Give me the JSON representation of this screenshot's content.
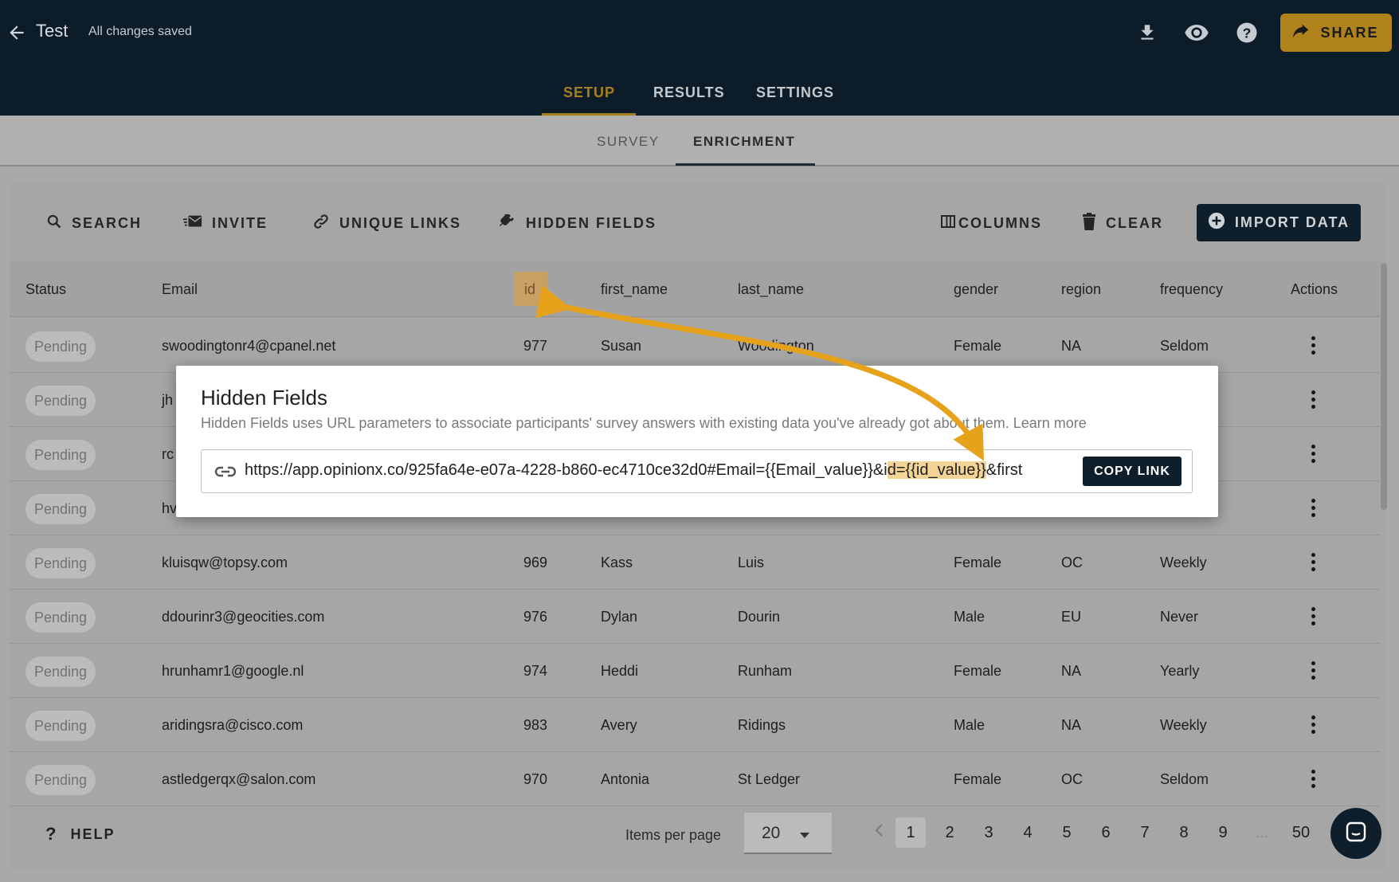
{
  "header": {
    "title": "Test",
    "saved_status": "All changes saved",
    "share_label": "SHARE",
    "nav_tabs": [
      "SETUP",
      "RESULTS",
      "SETTINGS"
    ],
    "sub_tabs": [
      "SURVEY",
      "ENRICHMENT"
    ]
  },
  "toolbar": {
    "search": "SEARCH",
    "invite": "INVITE",
    "unique_links": "UNIQUE LINKS",
    "hidden_fields": "HIDDEN FIELDS",
    "columns": "COLUMNS",
    "clear": "CLEAR",
    "import_data": "IMPORT DATA"
  },
  "table": {
    "columns": [
      "Status",
      "Email",
      "id",
      "first_name",
      "last_name",
      "gender",
      "region",
      "frequency",
      "Actions"
    ],
    "rows": [
      {
        "status": "Pending",
        "email": "swoodingtonr4@cpanel.net",
        "id": "977",
        "first_name": "Susan",
        "last_name": "Woodington",
        "gender": "Female",
        "region": "NA",
        "frequency": "Seldom"
      },
      {
        "status": "Pending",
        "email": "jh",
        "id": "",
        "first_name": "",
        "last_name": "",
        "gender": "",
        "region": "",
        "frequency": ""
      },
      {
        "status": "Pending",
        "email": "rc",
        "id": "",
        "first_name": "",
        "last_name": "",
        "gender": "",
        "region": "",
        "frequency": ""
      },
      {
        "status": "Pending",
        "email": "hv",
        "id": "",
        "first_name": "",
        "last_name": "",
        "gender": "",
        "region": "",
        "frequency": ""
      },
      {
        "status": "Pending",
        "email": "kluisqw@topsy.com",
        "id": "969",
        "first_name": "Kass",
        "last_name": "Luis",
        "gender": "Female",
        "region": "OC",
        "frequency": "Weekly"
      },
      {
        "status": "Pending",
        "email": "ddourinr3@geocities.com",
        "id": "976",
        "first_name": "Dylan",
        "last_name": "Dourin",
        "gender": "Male",
        "region": "EU",
        "frequency": "Never"
      },
      {
        "status": "Pending",
        "email": "hrunhamr1@google.nl",
        "id": "974",
        "first_name": "Heddi",
        "last_name": "Runham",
        "gender": "Female",
        "region": "NA",
        "frequency": "Yearly"
      },
      {
        "status": "Pending",
        "email": "aridingsra@cisco.com",
        "id": "983",
        "first_name": "Avery",
        "last_name": "Ridings",
        "gender": "Male",
        "region": "NA",
        "frequency": "Weekly"
      },
      {
        "status": "Pending",
        "email": "astledgerqx@salon.com",
        "id": "970",
        "first_name": "Antonia",
        "last_name": "St Ledger",
        "gender": "Female",
        "region": "OC",
        "frequency": "Seldom"
      }
    ]
  },
  "footer": {
    "help": "HELP",
    "items_per_page_label": "Items per page",
    "items_per_page_value": "20",
    "pages": [
      "1",
      "2",
      "3",
      "4",
      "5",
      "6",
      "7",
      "8",
      "9",
      "...",
      "50"
    ],
    "current_page": "1"
  },
  "modal": {
    "title": "Hidden Fields",
    "description": "Hidden Fields uses URL parameters to associate participants' survey answers with existing data you've already got about them. Learn more",
    "url_part1": "https://app.opinionx.co/925fa64e-e07a-4228-b860-ec4710ce32d0#Email={{Email_value}}&i",
    "url_highlight": "d={{id_value}}",
    "url_part3": "&first",
    "copy_label": "COPY LINK"
  },
  "colors": {
    "topbar_bg": "#0c1c28",
    "accent": "#a6801f",
    "highlight": "#f3d396",
    "arrow": "#e6a21a"
  }
}
